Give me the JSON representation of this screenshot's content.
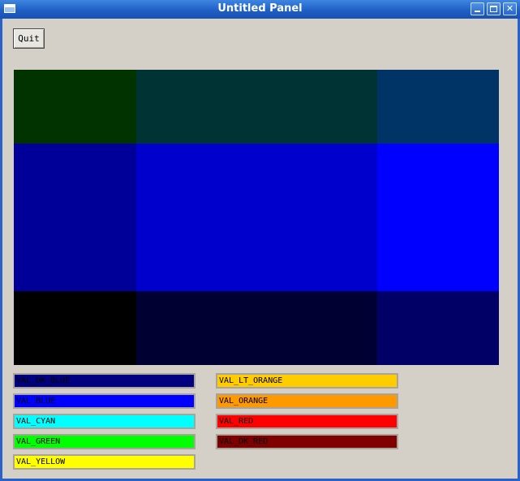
{
  "window": {
    "title": "Untitled Panel"
  },
  "toolbar": {
    "quit_label": "Quit"
  },
  "palette_grid": {
    "cells": [
      {
        "color": "#003300"
      },
      {
        "color": "#003333"
      },
      {
        "color": "#003366"
      },
      {
        "color": "#000099"
      },
      {
        "color": "#0000cc"
      },
      {
        "color": "#0000ff"
      },
      {
        "color": "#000000"
      },
      {
        "color": "#000033"
      },
      {
        "color": "#000066"
      }
    ]
  },
  "legend": {
    "left": [
      {
        "label": "VAL_DK_BLUE",
        "color": "#000080"
      },
      {
        "label": "VAL_BLUE",
        "color": "#0000ff"
      },
      {
        "label": "VAL_CYAN",
        "color": "#00ffff"
      },
      {
        "label": "VAL_GREEN",
        "color": "#00ff00"
      },
      {
        "label": "VAL_YELLOW",
        "color": "#ffff00"
      }
    ],
    "right": [
      {
        "label": "VAL_LT_ORANGE",
        "color": "#ffcc00"
      },
      {
        "label": "VAL_ORANGE",
        "color": "#ff9900"
      },
      {
        "label": "VAL_RED",
        "color": "#ff0000"
      },
      {
        "label": "VAL_DK_RED",
        "color": "#800000"
      }
    ]
  }
}
